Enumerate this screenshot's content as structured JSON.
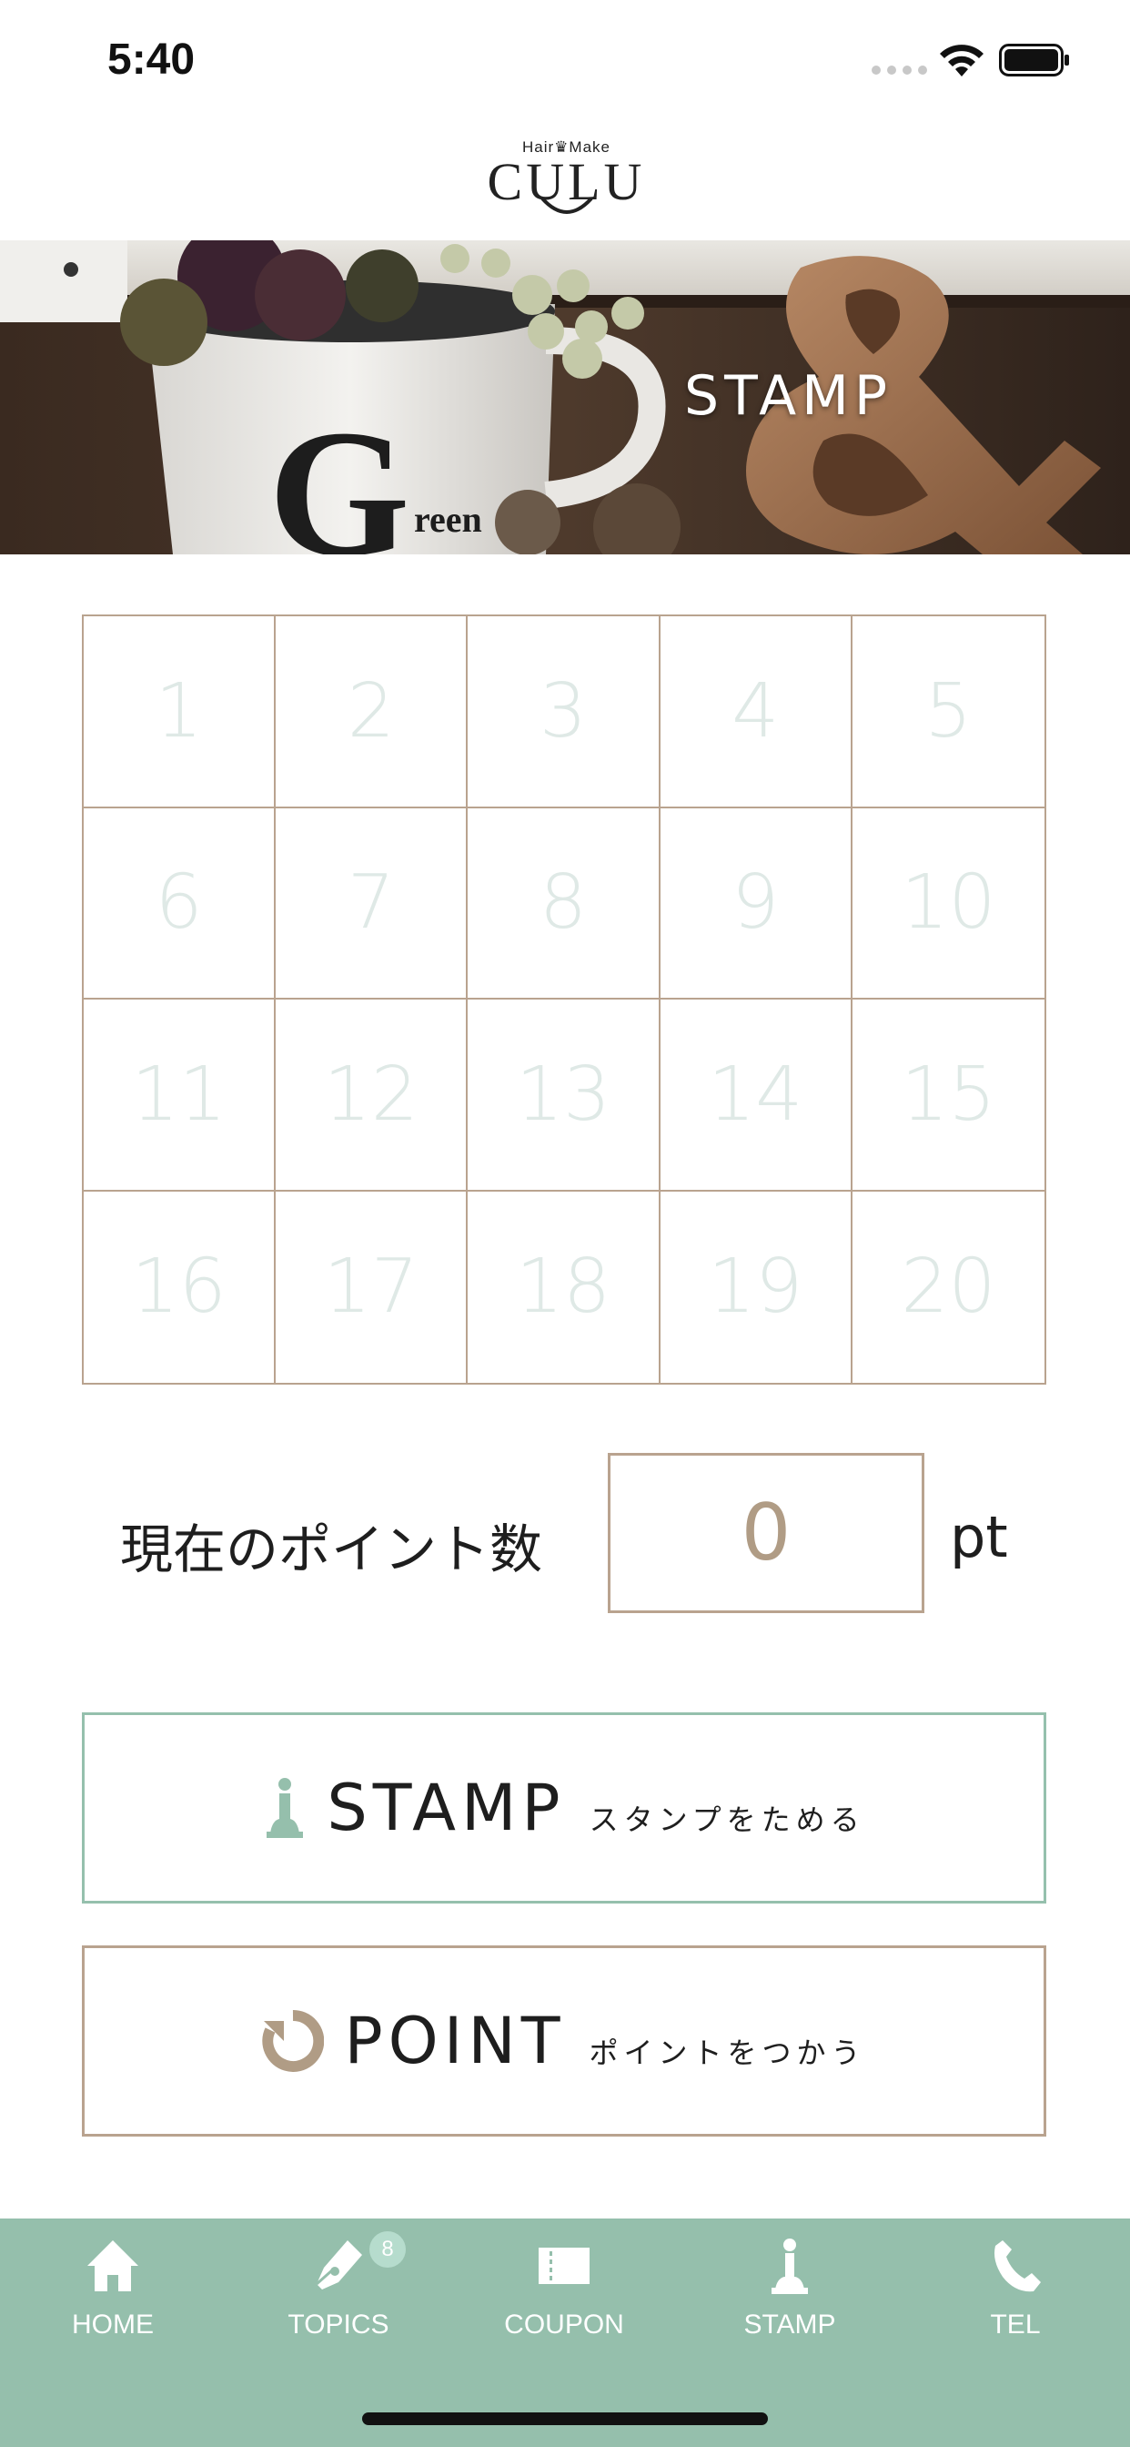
{
  "status_bar": {
    "time": "5:40"
  },
  "header": {
    "logo_small": "Hair♛Make",
    "logo_main": "CULU"
  },
  "hero": {
    "title": "STAMP"
  },
  "stamp_card": {
    "cells": [
      "1",
      "2",
      "3",
      "4",
      "5",
      "6",
      "7",
      "8",
      "9",
      "10",
      "11",
      "12",
      "13",
      "14",
      "15",
      "16",
      "17",
      "18",
      "19",
      "20"
    ]
  },
  "points": {
    "label": "現在のポイント数",
    "value": "0",
    "unit": "pt"
  },
  "actions": {
    "stamp": {
      "label": "STAMP",
      "sublabel": "スタンプをためる",
      "icon": "chess-pawn-icon"
    },
    "point": {
      "label": "POINT",
      "sublabel": "ポイントをつかう",
      "icon": "refresh-icon"
    }
  },
  "tabs": [
    {
      "label": "HOME",
      "icon": "home-icon"
    },
    {
      "label": "TOPICS",
      "icon": "pen-nib-icon",
      "badge": "8"
    },
    {
      "label": "COUPON",
      "icon": "ticket-icon"
    },
    {
      "label": "STAMP",
      "icon": "chess-pawn-icon"
    },
    {
      "label": "TEL",
      "icon": "phone-icon"
    }
  ],
  "colors": {
    "accent_green": "#95bfac",
    "accent_brown": "#b9a38f",
    "stamp_number": "#dfe9e6"
  }
}
